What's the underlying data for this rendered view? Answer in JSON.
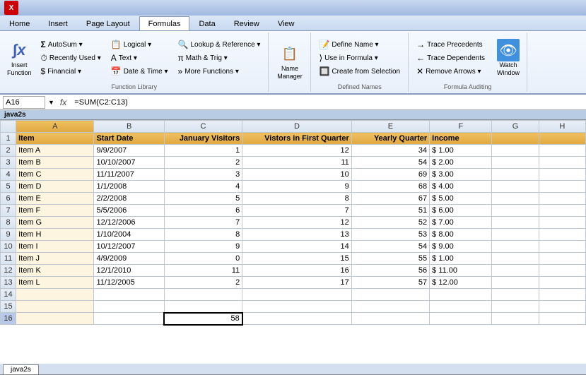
{
  "titlebar": {
    "logo": "X"
  },
  "tabs": [
    "Home",
    "Insert",
    "Page Layout",
    "Formulas",
    "Data",
    "Review",
    "View"
  ],
  "active_tab": "Formulas",
  "ribbon": {
    "groups": [
      {
        "label": "Function Library",
        "buttons": [
          {
            "id": "insert-function",
            "icon": "∫x",
            "label": "Insert\nFunction",
            "large": true
          },
          {
            "id": "autosum",
            "icon": "Σ",
            "label": "AutoSum ▾"
          },
          {
            "id": "recently-used",
            "icon": "🕐",
            "label": "Recently Used ▾"
          },
          {
            "id": "financial",
            "icon": "$",
            "label": "Financial ▾"
          },
          {
            "id": "logical",
            "icon": "?",
            "label": "Logical ▾"
          },
          {
            "id": "text",
            "icon": "A",
            "label": "Text ▾"
          },
          {
            "id": "date-time",
            "icon": "📅",
            "label": "Date & Time ▾"
          },
          {
            "id": "lookup-ref",
            "icon": "🔍",
            "label": "Lookup & Reference ▾"
          },
          {
            "id": "math-trig",
            "icon": "π",
            "label": "Math & Trig ▾"
          },
          {
            "id": "more-functions",
            "icon": "»",
            "label": "More Functions ▾"
          }
        ]
      },
      {
        "label": "",
        "buttons": [
          {
            "id": "name-manager",
            "icon": "📋",
            "label": "Name\nManager",
            "large": true
          }
        ]
      },
      {
        "label": "Defined Names",
        "buttons": [
          {
            "id": "define-name",
            "icon": "📝",
            "label": "Define Name ▾"
          },
          {
            "id": "use-in-formula",
            "icon": "⟩",
            "label": "Use in Formula ▾"
          },
          {
            "id": "create-from-selection",
            "icon": "🔲",
            "label": "Create from Selection"
          }
        ]
      },
      {
        "label": "Formula Auditing",
        "buttons": [
          {
            "id": "trace-precedents",
            "icon": "→",
            "label": "Trace Precedents"
          },
          {
            "id": "trace-dependents",
            "icon": "←",
            "label": "Trace Dependents"
          },
          {
            "id": "remove-arrows",
            "icon": "✕",
            "label": "Remove Arrows ▾"
          },
          {
            "id": "watch-window",
            "icon": "👁",
            "label": "Watch\nWindow",
            "large": true
          }
        ]
      }
    ]
  },
  "formulabar": {
    "namebox": "A16",
    "formula": "=SUM(C2:C13)"
  },
  "sheetname": "java2s",
  "sheets": [
    "java2s"
  ],
  "columns": [
    "",
    "A",
    "B",
    "C",
    "D",
    "E",
    "F",
    "G",
    "H"
  ],
  "headers": [
    "Item",
    "Start Date",
    "January Visitors",
    "Vistors in First Quarter",
    "Yearly Quarter",
    "Income",
    "",
    ""
  ],
  "rows": [
    {
      "num": 1,
      "isHeader": true,
      "cells": [
        "Item",
        "Start Date",
        "January Visitors",
        "Vistors in First Quarter",
        "Yearly Quarter",
        "Income",
        "",
        ""
      ]
    },
    {
      "num": 2,
      "cells": [
        "Item A",
        "9/9/2007",
        "1",
        "12",
        "34",
        "$ 1.00",
        "",
        ""
      ]
    },
    {
      "num": 3,
      "cells": [
        "Item B",
        "10/10/2007",
        "2",
        "11",
        "54",
        "$ 2.00",
        "",
        ""
      ]
    },
    {
      "num": 4,
      "cells": [
        "Item C",
        "11/11/2007",
        "3",
        "10",
        "69",
        "$ 3.00",
        "",
        ""
      ]
    },
    {
      "num": 5,
      "cells": [
        "Item D",
        "1/1/2008",
        "4",
        "9",
        "68",
        "$ 4.00",
        "",
        ""
      ]
    },
    {
      "num": 6,
      "cells": [
        "Item E",
        "2/2/2008",
        "5",
        "8",
        "67",
        "$ 5.00",
        "",
        ""
      ]
    },
    {
      "num": 7,
      "cells": [
        "Item F",
        "5/5/2006",
        "6",
        "7",
        "51",
        "$ 6.00",
        "",
        ""
      ]
    },
    {
      "num": 8,
      "cells": [
        "Item G",
        "12/12/2006",
        "7",
        "12",
        "52",
        "$ 7.00",
        "",
        ""
      ]
    },
    {
      "num": 9,
      "cells": [
        "Item H",
        "1/10/2004",
        "8",
        "13",
        "53",
        "$ 8.00",
        "",
        ""
      ]
    },
    {
      "num": 10,
      "cells": [
        "Item I",
        "10/12/2007",
        "9",
        "14",
        "54",
        "$ 9.00",
        "",
        ""
      ]
    },
    {
      "num": 11,
      "cells": [
        "Item J",
        "4/9/2009",
        "0",
        "15",
        "55",
        "$ 1.00",
        "",
        ""
      ]
    },
    {
      "num": 12,
      "cells": [
        "Item K",
        "12/1/2010",
        "11",
        "16",
        "56",
        "$ 11.00",
        "",
        ""
      ]
    },
    {
      "num": 13,
      "cells": [
        "Item L",
        "11/12/2005",
        "2",
        "17",
        "57",
        "$ 12.00",
        "",
        ""
      ]
    },
    {
      "num": 14,
      "cells": [
        "",
        "",
        "",
        "",
        "",
        "",
        "",
        ""
      ]
    },
    {
      "num": 15,
      "cells": [
        "",
        "",
        "",
        "",
        "",
        "",
        "",
        ""
      ]
    },
    {
      "num": 16,
      "cells": [
        "",
        "",
        "58",
        "",
        "",
        "",
        "",
        ""
      ],
      "isActive": true
    }
  ]
}
